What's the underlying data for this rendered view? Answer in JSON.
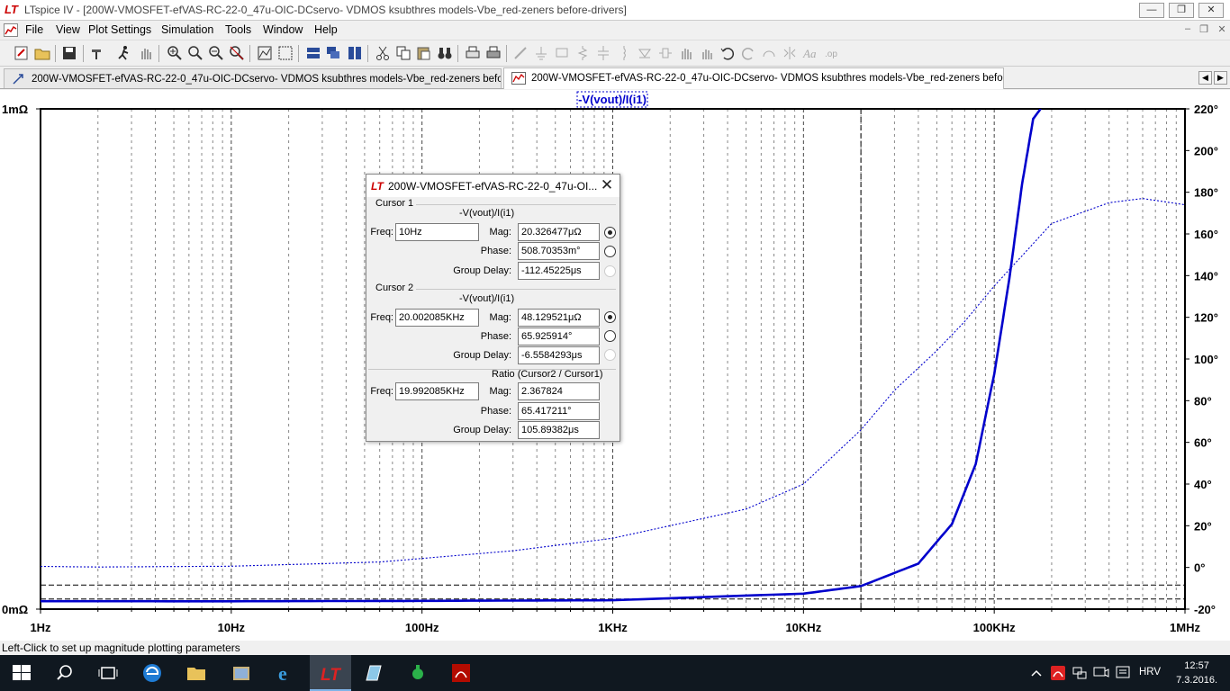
{
  "window": {
    "title": "LTspice IV - [200W-VMOSFET-efVAS-RC-22-0_47u-OIC-DCservo- VDMOS ksubthres models-Vbe_red-zeners before-drivers]",
    "minimize": "—",
    "maximize": "❐",
    "close": "✕"
  },
  "menu": {
    "items": [
      "File",
      "View",
      "Plot Settings",
      "Simulation",
      "Tools",
      "Window",
      "Help"
    ],
    "mdi_controls": [
      "–",
      "❐",
      "✕"
    ]
  },
  "tabs": [
    {
      "label": "200W-VMOSFET-efVAS-RC-22-0_47u-OIC-DCservo- VDMOS ksubthres models-Vbe_red-zeners before-drivers",
      "icon": "schematic-icon",
      "active": false
    },
    {
      "label": "200W-VMOSFET-efVAS-RC-22-0_47u-OIC-DCservo- VDMOS ksubthres models-Vbe_red-zeners before-drivers",
      "icon": "waveform-icon",
      "active": true
    }
  ],
  "tab_scroll": [
    "◀",
    "▶"
  ],
  "plot": {
    "trace_title": "-V(vout)/I(i1)",
    "left_axis_labels": [
      "1mΩ",
      "0mΩ"
    ],
    "right_axis_labels": [
      "220°",
      "200°",
      "180°",
      "160°",
      "140°",
      "120°",
      "100°",
      "80°",
      "60°",
      "40°",
      "20°",
      "0°",
      "-20°"
    ],
    "x_axis_labels": [
      "1Hz",
      "10Hz",
      "100Hz",
      "1KHz",
      "10KHz",
      "100KHz",
      "1MHz"
    ],
    "trace_color": "#0000cc"
  },
  "chart_data": {
    "type": "line",
    "title": "-V(vout)/I(i1)",
    "x_scale": "log",
    "xlim": [
      1,
      1000000
    ],
    "ylim_magnitude": [
      0,
      1
    ],
    "y_units_magnitude": "mΩ",
    "ylim_phase": [
      -20,
      220
    ],
    "y_units_phase": "°",
    "grid": true,
    "series": [
      {
        "axis": "left",
        "style": "solid",
        "x": [
          1,
          10,
          100,
          1000,
          10000,
          20000,
          40000,
          60000,
          80000,
          100000,
          120000,
          140000,
          160000,
          175000
        ],
        "values": [
          0.0158,
          0.0157,
          0.0165,
          0.0178,
          0.031,
          0.046,
          0.091,
          0.17,
          0.29,
          0.47,
          0.66,
          0.85,
          0.98,
          1.0
        ]
      },
      {
        "axis": "right",
        "style": "dotted",
        "x": [
          1,
          2,
          10,
          60,
          300,
          1000,
          5000,
          10000,
          20000,
          30000,
          50000,
          70000,
          100000,
          200000,
          400000,
          600000,
          1000000
        ],
        "values": [
          0.5,
          0.2,
          0.6,
          2.6,
          8,
          14,
          28,
          40,
          66,
          85,
          104,
          118,
          135,
          165,
          175,
          177,
          174
        ]
      }
    ],
    "cursors": [
      {
        "x": 10,
        "magnitude": 0.0203
      },
      {
        "x": 20002.085,
        "magnitude": 0.0481
      }
    ]
  },
  "dialog": {
    "title": "200W-VMOSFET-efVAS-RC-22-0_47u-OI...",
    "close": "✕",
    "cursor1": {
      "heading": "Cursor 1",
      "trace": "-V(vout)/I(i1)",
      "freq_label": "Freq:",
      "freq": "10Hz",
      "mag_label": "Mag:",
      "mag": "20.326477μΩ",
      "phase_label": "Phase:",
      "phase": "508.70353m°",
      "gd_label": "Group Delay:",
      "gd": "-112.45225μs"
    },
    "cursor2": {
      "heading": "Cursor 2",
      "trace": "-V(vout)/I(i1)",
      "freq_label": "Freq:",
      "freq": "20.002085KHz",
      "mag_label": "Mag:",
      "mag": "48.129521μΩ",
      "phase_label": "Phase:",
      "phase": "65.925914°",
      "gd_label": "Group Delay:",
      "gd": "-6.5584293μs"
    },
    "ratio": {
      "heading": "Ratio (Cursor2 / Cursor1)",
      "freq_label": "Freq:",
      "freq": "19.992085KHz",
      "mag_label": "Mag:",
      "mag": "2.367824",
      "phase_label": "Phase:",
      "phase": "65.417211°",
      "gd_label": "Group Delay:",
      "gd": "105.89382μs"
    }
  },
  "status": {
    "text": "Left-Click to set up magnitude plotting parameters"
  },
  "taskbar": {
    "lang": "HRV",
    "time": "12:57",
    "date": "7.3.2016."
  }
}
